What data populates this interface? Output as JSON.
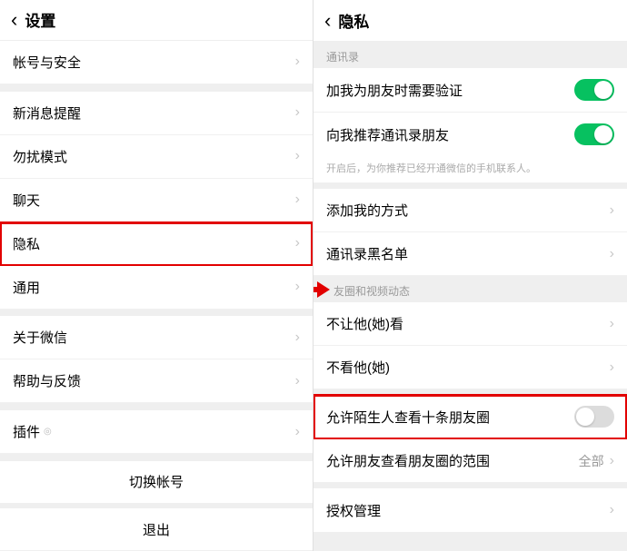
{
  "left": {
    "title": "设置",
    "items": {
      "account": "帐号与安全",
      "msg": "新消息提醒",
      "dnd": "勿扰模式",
      "chat": "聊天",
      "privacy": "隐私",
      "general": "通用",
      "about": "关于微信",
      "help": "帮助与反馈",
      "plugins": "插件",
      "switch": "切换帐号",
      "logout": "退出"
    }
  },
  "right": {
    "title": "隐私",
    "sections": {
      "contacts": "通讯录",
      "moments": "友圈和视频动态"
    },
    "rows": {
      "verify": "加我为朋友时需要验证",
      "recommend": "向我推荐通讯录朋友",
      "recommend_sub": "开启后，为你推荐已经开通微信的手机联系人。",
      "addways": "添加我的方式",
      "blacklist": "通讯录黑名单",
      "blockher": "不让他(她)看",
      "dontsee": "不看他(她)",
      "stranger": "允许陌生人查看十条朋友圈",
      "scope": "允许朋友查看朋友圈的范围",
      "scope_val": "全部",
      "auth": "授权管理"
    }
  }
}
